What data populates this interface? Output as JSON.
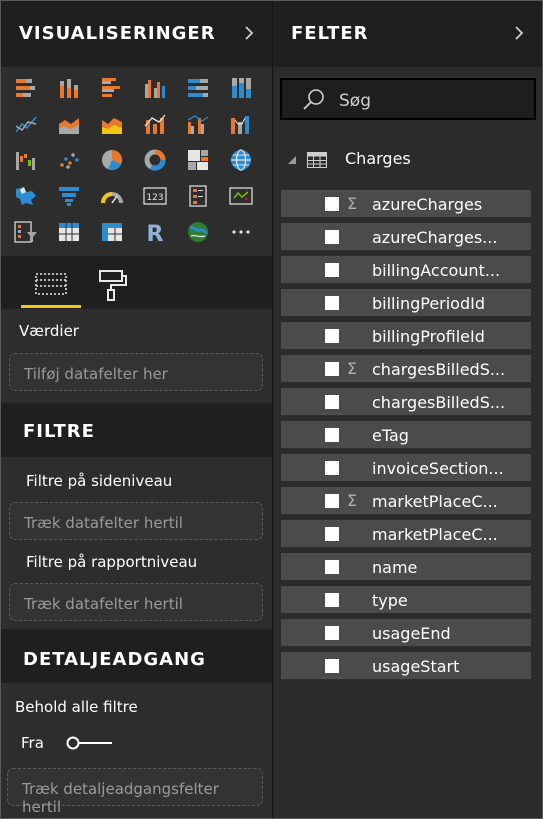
{
  "visualizations": {
    "title": "VISUALISERINGER",
    "icons": [
      "stacked-bar-chart-icon",
      "stacked-column-chart-icon",
      "clustered-bar-chart-icon",
      "clustered-column-chart-icon",
      "100-stacked-bar-chart-icon",
      "100-stacked-column-chart-icon",
      "line-chart-icon",
      "area-chart-icon",
      "stacked-area-chart-icon",
      "line-and-column-chart-icon",
      "line-and-clustered-column-chart-icon",
      "ribbon-chart-icon",
      "waterfall-chart-icon",
      "scatter-chart-icon",
      "pie-chart-icon",
      "donut-chart-icon",
      "treemap-icon",
      "map-icon",
      "filled-map-icon",
      "funnel-icon",
      "gauge-icon",
      "card-icon",
      "multi-row-card-icon",
      "kpi-icon",
      "slicer-icon",
      "table-icon",
      "matrix-icon",
      "r-visual-icon",
      "arcgis-map-icon",
      "more-visuals-icon"
    ]
  },
  "values": {
    "label": "Værdier",
    "placeholder": "Tilføj datafelter her"
  },
  "filters": {
    "title": "FILTRE",
    "page_label": "Filtre på sideniveau",
    "page_placeholder": "Træk datafelter hertil",
    "report_label": "Filtre på rapportniveau",
    "report_placeholder": "Træk datafelter hertil"
  },
  "drillthrough": {
    "title": "DETALJEADGANG",
    "keep_all_label": "Behold alle filtre",
    "toggle_label": "Fra",
    "placeholder": "Træk detaljeadgangsfelter hertil"
  },
  "fields_panel": {
    "title": "FELTER",
    "search_placeholder": "Søg",
    "table_name": "Charges",
    "fields": [
      {
        "name": "azureCharges",
        "sigma": true
      },
      {
        "name": "azureCharges...",
        "sigma": false
      },
      {
        "name": "billingAccount...",
        "sigma": false
      },
      {
        "name": "billingPeriodId",
        "sigma": false
      },
      {
        "name": "billingProfileId",
        "sigma": false
      },
      {
        "name": "chargesBilledS...",
        "sigma": true
      },
      {
        "name": "chargesBilledS...",
        "sigma": false
      },
      {
        "name": "eTag",
        "sigma": false
      },
      {
        "name": "invoiceSection...",
        "sigma": false
      },
      {
        "name": "marketPlaceC...",
        "sigma": true
      },
      {
        "name": "marketPlaceC...",
        "sigma": false
      },
      {
        "name": "name",
        "sigma": false
      },
      {
        "name": "type",
        "sigma": false
      },
      {
        "name": "usageEnd",
        "sigma": false
      },
      {
        "name": "usageStart",
        "sigma": false
      }
    ]
  },
  "colors": {
    "accent": "#f2c80f",
    "orange": "#e8792c",
    "blue": "#2d8bd0",
    "gray": "#a0a0a0"
  }
}
